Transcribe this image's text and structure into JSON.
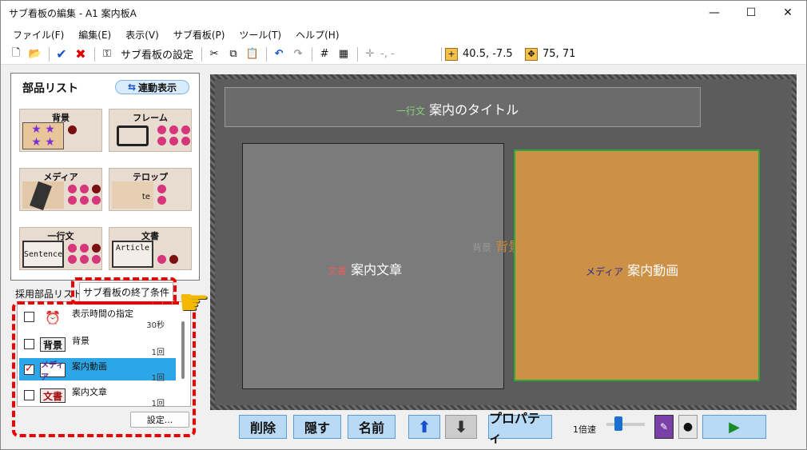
{
  "window": {
    "title": "サブ看板の編集 - A1 案内板A",
    "minimize": "—",
    "maximize": "☐",
    "close": "✕"
  },
  "menu": [
    "ファイル(F)",
    "編集(E)",
    "表示(V)",
    "サブ看板(P)",
    "ツール(T)",
    "ヘルプ(H)"
  ],
  "toolbar": {
    "subboard_settings": "サブ看板の設定",
    "cursor": "-, -",
    "position": "40.5, -7.5",
    "size": "75, 71"
  },
  "parts": {
    "heading": "部品リスト",
    "link_label": "連動表示",
    "tiles": [
      {
        "label": "背景"
      },
      {
        "label": "フレーム"
      },
      {
        "label": "メディア"
      },
      {
        "label": "テロップ"
      },
      {
        "label": "一行文",
        "thumb_text": "Sentence"
      },
      {
        "label": "文書",
        "thumb_text": "Article"
      }
    ]
  },
  "tabs": {
    "adopted": "採用部品リスト",
    "end_condition": "サブ看板の終了条件"
  },
  "conditions": [
    {
      "label": "表示時間の指定",
      "count": "30秒",
      "icon": "clock-icon",
      "checked": false
    },
    {
      "label": "背景",
      "count": "1回",
      "icon_text": "背景",
      "checked": false
    },
    {
      "label": "案内動画",
      "count": "1回",
      "icon_text": "メディア",
      "checked": true
    },
    {
      "label": "案内文章",
      "count": "1回",
      "icon_text": "文書",
      "checked": false
    }
  ],
  "settings_button": "設定...",
  "canvas": {
    "title_kind": "一行文",
    "title_text": "案内のタイトル",
    "bg_kind": "背景",
    "bg_text": "背景",
    "doc_kind": "文書",
    "doc_text": "案内文章",
    "media_kind": "メディア",
    "media_text": "案内動画"
  },
  "bottom": {
    "delete": "削除",
    "hide": "隠す",
    "rename": "名前",
    "properties": "プロパティ",
    "speed": "1倍速"
  },
  "colors": {
    "media_box": "#cc9147",
    "selection": "#2da6e8",
    "highlight": "#e00000"
  }
}
